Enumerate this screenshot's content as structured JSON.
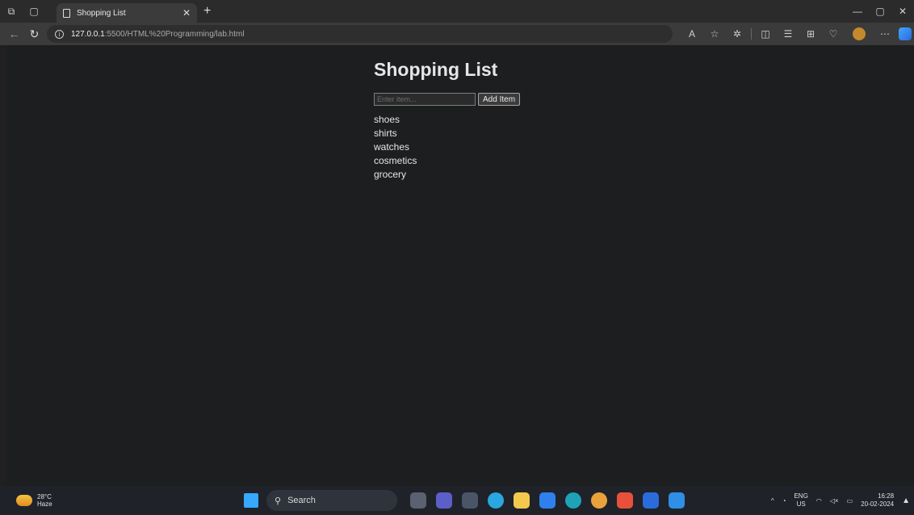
{
  "browser": {
    "tab_title": "Shopping List",
    "url_host": "127.0.0.1",
    "url_path": ":5500/HTML%20Programming/lab.html"
  },
  "page": {
    "heading": "Shopping List",
    "input_placeholder": "Enter item...",
    "add_button_label": "Add Item",
    "items": [
      "shoes",
      "shirts",
      "watches",
      "cosmetics",
      "grocery"
    ]
  },
  "taskbar": {
    "temperature": "28°C",
    "weather": "Haze",
    "search_label": "Search",
    "language": "ENG",
    "region": "US",
    "time": "16:28",
    "date": "20-02-2024"
  },
  "icons": [
    "tab-actions-icon",
    "workspaces-icon",
    "page-icon",
    "close-icon",
    "new-tab-icon",
    "back-icon",
    "reload-icon",
    "info-icon",
    "read-aloud-icon",
    "favorite-icon",
    "extensions-icon",
    "split-screen-icon",
    "favorites-icon",
    "collections-icon",
    "browser-essentials-icon",
    "profile-icon",
    "more-icon",
    "copilot-icon",
    "minimize-icon",
    "maximize-icon",
    "window-close-icon",
    "weather-icon",
    "windows-start-icon",
    "search-icon",
    "chevron-up-icon",
    "wifi-icon",
    "volume-icon",
    "battery-icon",
    "bell-icon"
  ]
}
